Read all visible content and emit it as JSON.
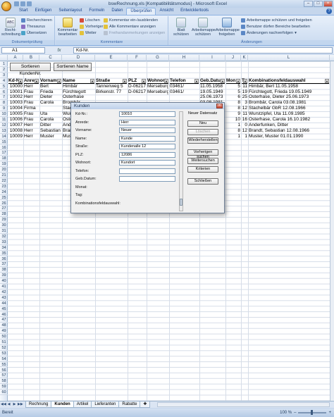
{
  "window": {
    "title": "bswRechnung.xls [Kompatibilitätsmodus] - Microsoft Excel"
  },
  "ribbon_tabs": [
    "Start",
    "Einfügen",
    "Seitenlayout",
    "Formeln",
    "Daten",
    "Überprüfen",
    "Ansicht",
    "Entwicklertools"
  ],
  "ribbon": {
    "groups": {
      "doc_check": "Dokumentprüfung",
      "comments": "Kommentare",
      "changes": "Änderungen"
    },
    "spelling": "Recht-schreibung",
    "research": "Recherchieren",
    "thesaurus": "Thesaurus",
    "translate": "Übersetzen",
    "edit_comment": "Kommentar bearbeiten",
    "delete": "Löschen",
    "previous": "Vorheriger",
    "next": "Weiter",
    "show_hide_comment": "Kommentar ein-/ausblenden",
    "show_all_comments": "Alle Kommentare anzeigen",
    "show_ink": "Freihandanmerkungen anzeigen",
    "protect_sheet": "Blatt schützen",
    "protect_workbook": "Arbeitsmappe schützen",
    "share_workbook": "Arbeitsmappe freigeben",
    "protect_share": "Arbeitsmappe schützen und freigeben",
    "allow_edit_ranges": "Benutzer dürfen Bereiche bearbeiten",
    "track_changes": "Änderungen nachverfolgen"
  },
  "formula_bar": {
    "name_box": "A1",
    "fx": "fx",
    "value": "Kd-Nr."
  },
  "columns": [
    "A",
    "B",
    "C",
    "D",
    "E",
    "F",
    "G",
    "H",
    "I",
    "J",
    "K",
    "L"
  ],
  "row_numbers": [
    "1",
    "2",
    "3",
    "4",
    "5",
    "6",
    "7",
    "8",
    "9",
    "10",
    "11",
    "12",
    "13",
    "14",
    "15",
    "16",
    "17",
    "18",
    "19",
    "20",
    "21",
    "22",
    "23",
    "24",
    "25",
    "26",
    "27",
    "28",
    "29",
    "30",
    "31",
    "32",
    "33",
    "34",
    "35",
    "36",
    "37",
    "38",
    "39",
    "40",
    "41",
    "42",
    "43",
    "44",
    "45",
    "46",
    "47",
    "48",
    "49",
    "50",
    "51",
    "52",
    "53",
    "54",
    "55",
    "56",
    "57",
    "58",
    "59",
    "60"
  ],
  "sheet_buttons": {
    "sort_kdnr": "Sortieren KundenNr.",
    "sort_name": "Sortieren Name"
  },
  "table": {
    "headers": [
      "Kd-N",
      "Anre",
      "Vornam",
      "Name",
      "Straße",
      "PLZ",
      "Wohnort",
      "Telefon",
      "Geb.Datu",
      "Mon",
      "T",
      "Kombinationsfeldauswahl"
    ],
    "rows": [
      [
        "10000",
        "Herr",
        "Bert",
        "Himbär",
        "Tannenweg 5",
        "D-06217",
        "Merseburg",
        "03461/",
        "11.05.1958",
        "5",
        "11",
        "Himbär, Bert 11.05.1958"
      ],
      [
        "10001",
        "Frau",
        "Frieda",
        "Fürchtegott",
        "Birkenstr. 77",
        "D-06217",
        "Merseburg",
        "03461/",
        "19.05.1949",
        "5",
        "19",
        "Fürchtegott, Frieda 19.05.1949"
      ],
      [
        "10002",
        "Herr",
        "Dieter",
        "Osterhase",
        "",
        "",
        "",
        "",
        "25.06.1973",
        "6",
        "25",
        "Osterhase, Dieter 25.06.1973"
      ],
      [
        "10003",
        "Frau",
        "Carola",
        "Brombär",
        "",
        "",
        "",
        "",
        "03.08.1981",
        "8",
        "3",
        "Brombär, Carola 03.08.1981"
      ],
      [
        "10004",
        "Firma",
        "",
        "Stachelbär",
        "",
        "",
        "",
        "",
        "",
        "8",
        "12",
        "Stachelbär GbR 12.08.1966"
      ],
      [
        "10005",
        "Frau",
        "Uta",
        "Wurstzipfel",
        "",
        "",
        "",
        "",
        "",
        "9",
        "11",
        "Wurstzipfel, Uta 11.09.1985"
      ],
      [
        "10006",
        "Frau",
        "Carola",
        "Osterhase",
        "",
        "",
        "",
        "",
        "",
        "10",
        "16",
        "Osterhase, Carola 16.10.1982"
      ],
      [
        "10007",
        "Herr",
        "Ditter",
        "Anderfunken",
        "",
        "",
        "",
        "",
        "",
        "1",
        "0",
        "Anderfunken, Ditter"
      ],
      [
        "10008",
        "Herr",
        "Sebastian",
        "Brandt",
        "",
        "",
        "",
        "",
        "",
        "8",
        "12",
        "Brandt, Sebastian 12.08.1966"
      ],
      [
        "10009",
        "Herr",
        "Muster",
        "Mustermann",
        "",
        "",
        "",
        "",
        "",
        "1",
        "1",
        "Muster, Muster 01.01.1990"
      ]
    ]
  },
  "dialog": {
    "title": "Kunden",
    "close": "×",
    "record_info": "Neuer Datensatz",
    "fields": [
      {
        "label": "Kd-Nr.:",
        "value": "10010"
      },
      {
        "label": "Anrede:",
        "value": "Herr"
      },
      {
        "label": "Vorname:",
        "value": "Neuer"
      },
      {
        "label": "Name:",
        "value": "Kunde"
      },
      {
        "label": "Straße:",
        "value": "Kundenalle 12"
      },
      {
        "label": "PLZ:",
        "value": "12086"
      },
      {
        "label": "Wohnort:",
        "value": "Kundort"
      },
      {
        "label": "Telefon:",
        "value": ""
      },
      {
        "label": "Geb.Datum:",
        "value": ""
      },
      {
        "label": "Monat:",
        "value": null
      },
      {
        "label": "Tag:",
        "value": null
      },
      {
        "label": "Kombinationsfeldauswahl:",
        "value": null
      }
    ],
    "buttons": {
      "new": "Neu",
      "delete": "Löschen",
      "restore": "Wiederherstellen",
      "find_prev": "Vorherigen suchen",
      "find_next": "Weitersuchen",
      "criteria": "Kriterien",
      "close": "Schließen"
    }
  },
  "sheet_tabs": [
    "Rechnung",
    "Kunden",
    "Artikel",
    "Lieferanten",
    "Rabatte"
  ],
  "status": {
    "text": "Bereit",
    "zoom": "100 %"
  }
}
